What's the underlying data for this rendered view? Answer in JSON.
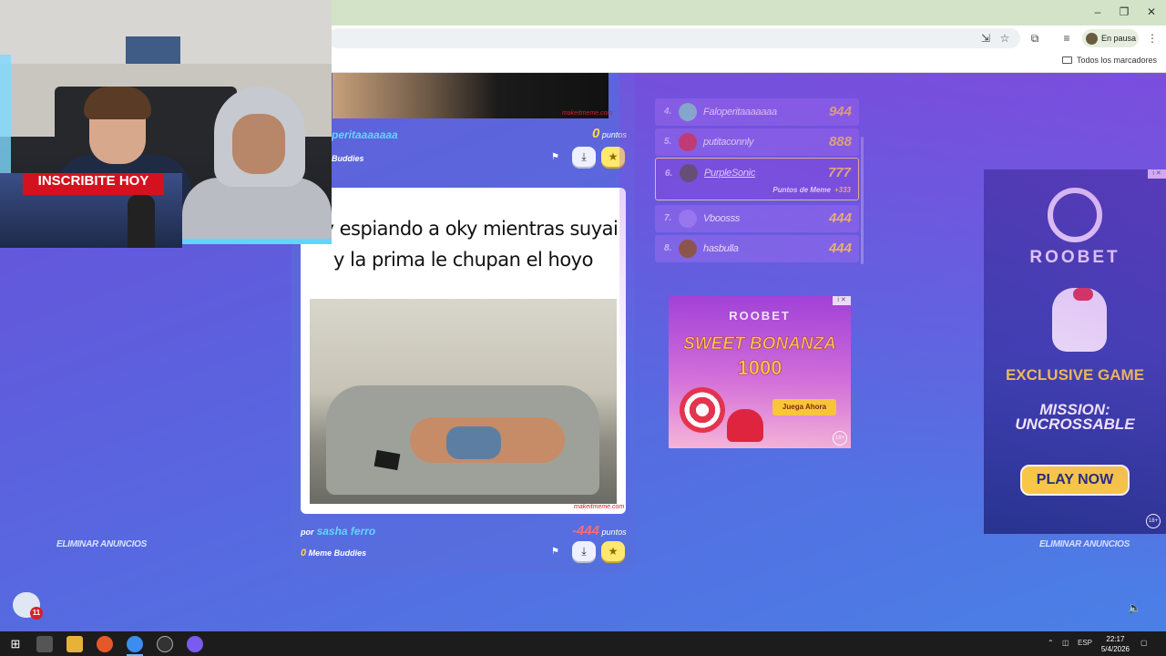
{
  "browser": {
    "profile_status": "En pausa",
    "bookmarks_all": "Todos los marcadores"
  },
  "webcam": {
    "promo_text": "INSCRIBITE HOY"
  },
  "feed": {
    "top_post": {
      "author_partial": "peritaaaaaaa",
      "points_value": "0",
      "points_label": "puntos",
      "buddies_partial": "Buddies",
      "watermark": "makeitmeme.com"
    },
    "main_post": {
      "caption_line1": "rry espiando a oky mientras suyai",
      "caption_line2": "y la prima le chupan el hoyo",
      "watermark": "makeitmeme.com",
      "by_label": "por",
      "author": "sasha ferro",
      "points_value": "-444",
      "points_label": "puntos",
      "buddies_count": "0",
      "buddies_label": "Meme Buddies"
    }
  },
  "leaderboard": {
    "rows": [
      {
        "rank": "4.",
        "name": "Faloperitaaaaaaa",
        "score": "944",
        "avatar_color": "#7fd8c4"
      },
      {
        "rank": "5.",
        "name": "putitaconnly",
        "score": "888",
        "avatar_color": "#d23a4a"
      },
      {
        "rank": "7.",
        "name": "Vboosss",
        "score": "444",
        "avatar_color": "#9a86f2"
      },
      {
        "rank": "8.",
        "name": "hasbulla",
        "score": "444",
        "avatar_color": "#8b5a2b"
      }
    ],
    "me": {
      "rank": "6.",
      "name": "PurpleSonic",
      "score": "777",
      "sub_label": "Puntos de Meme",
      "sub_value": "+333"
    }
  },
  "ads": {
    "remove_ads": "ELIMINAR ANUNCIOS",
    "small": {
      "brand": "ROOBET",
      "title1": "SWEET BONANZA",
      "title2": "1000",
      "cta": "Juega Ahora",
      "age": "18+"
    },
    "big": {
      "brand": "ROOBET",
      "headline": "EXCLUSIVE GAME",
      "game_line1": "MISSION:",
      "game_line2": "UNCROSSABLE",
      "cta": "PLAY NOW",
      "age": "18+"
    }
  },
  "chat": {
    "badge": "11"
  },
  "taskbar": {
    "lang": "ESP",
    "time": "22:17",
    "date": "5/4/2026"
  }
}
